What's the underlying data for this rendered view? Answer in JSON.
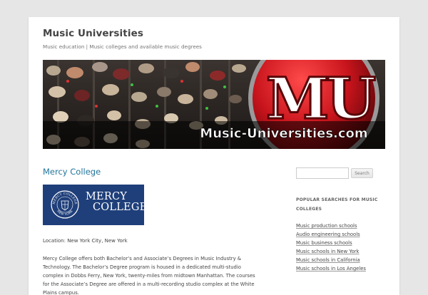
{
  "site": {
    "title": "Music Universities",
    "description": "Music education | Music colleges and available music degrees"
  },
  "header_banner": {
    "logo_letters": "MU",
    "domain_text": "Music-Universities.com",
    "accent_color": "#c8141c"
  },
  "post": {
    "title": "Mercy College",
    "logo": {
      "line1": "MERCY",
      "line2": "COLLEGE",
      "seal_top": "MERCY COLLEGE",
      "seal_bottom": "NEW YORK",
      "background": "#1f3f7a"
    },
    "location": "Location: New York City, New York",
    "body": "Mercy College offers both Bachelor’s and Associate’s Degrees in Music Industry & Technology. The Bachelor’s Degree program is housed in a dedicated multi-studio complex in Dobbs Ferry, New York, twenty-miles from midtown Manhattan. The courses for the Associate’s Degree are offered in a multi-recording studio complex at the White Plains campus."
  },
  "sidebar": {
    "search": {
      "value": "",
      "button_label": "Search"
    },
    "popular": {
      "title": "POPULAR SEARCHES FOR MUSIC COLLEGES",
      "links": [
        "Music production schools",
        "Audio engineering schools",
        "Music business schools",
        "Music schools in New York",
        "Music schools in California",
        "Music schools in Los Angeles"
      ]
    }
  },
  "colors": {
    "link": "#21759b",
    "page_background": "#e6e6e6"
  }
}
